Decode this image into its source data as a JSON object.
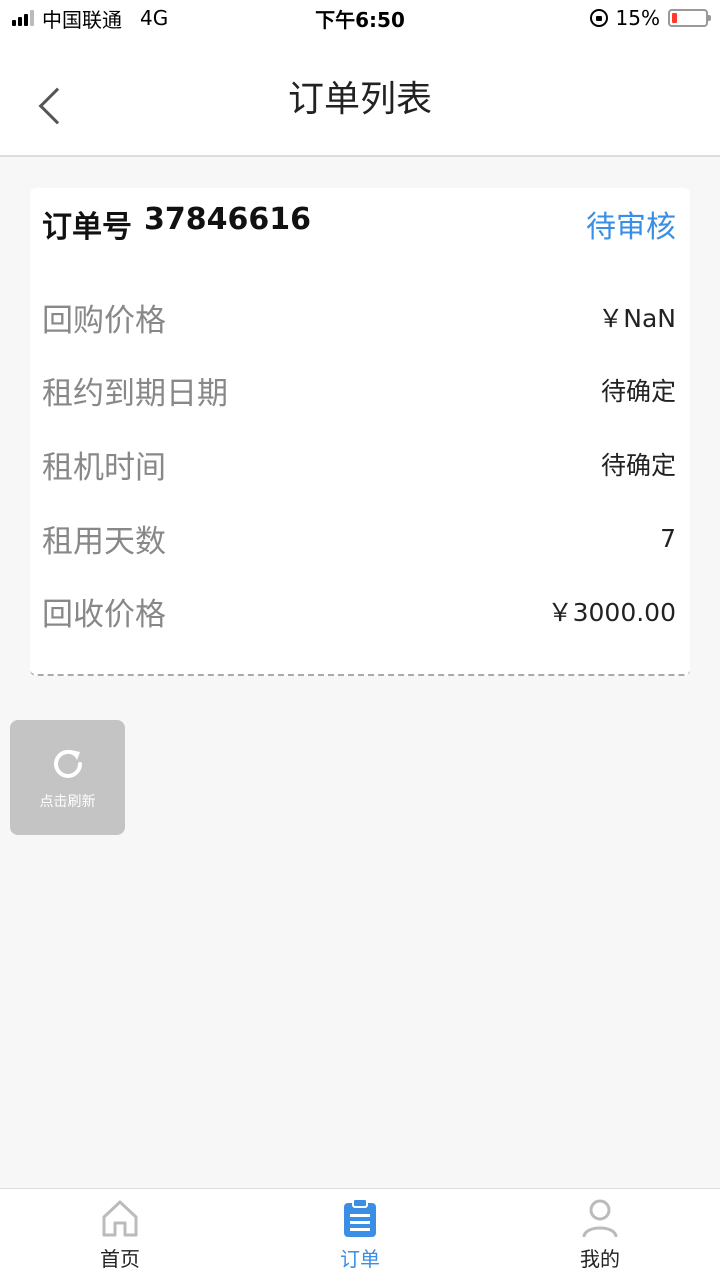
{
  "status_bar": {
    "carrier": "中国联通",
    "network": "4G",
    "time": "下午6:50",
    "battery": "15%",
    "battery_level": 0.15
  },
  "nav": {
    "title": "订单列表"
  },
  "order": {
    "number_label": "订单号",
    "number": "37846616",
    "status": "待审核",
    "status_color": "#3a8ee6",
    "rows": [
      {
        "label": "回购价格",
        "value": "￥NaN"
      },
      {
        "label": "租约到期日期",
        "value": "待确定"
      },
      {
        "label": "租机时间",
        "value": "待确定"
      },
      {
        "label": "租用天数",
        "value": "7"
      },
      {
        "label": "回收价格",
        "value": "￥3000.00"
      }
    ]
  },
  "refresh": {
    "label": "点击刷新"
  },
  "tabs": [
    {
      "label": "首页",
      "icon": "home-icon",
      "active": false
    },
    {
      "label": "订单",
      "icon": "clipboard-icon",
      "active": true
    },
    {
      "label": "我的",
      "icon": "user-icon",
      "active": false
    }
  ],
  "colors": {
    "accent": "#3a8ee6",
    "background": "#f7f7f7"
  }
}
